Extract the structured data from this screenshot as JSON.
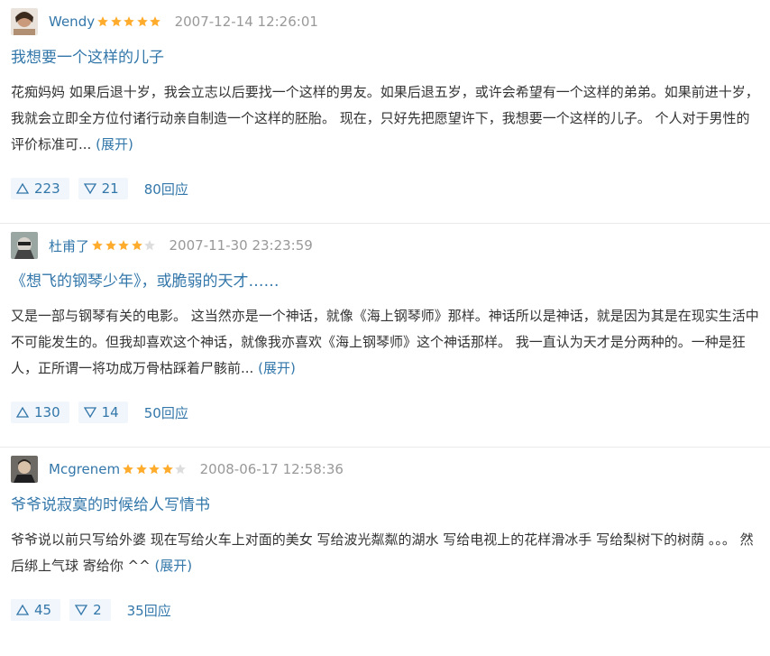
{
  "reviews": [
    {
      "user": "Wendy",
      "rating": 5,
      "time": "2007-12-14 12:26:01",
      "title": "我想要一个这样的儿子",
      "body": "花痴妈妈 如果后退十岁，我会立志以后要找一个这样的男友。如果后退五岁，或许会希望有一个这样的弟弟。如果前进十岁，我就会立即全方位付诸行动亲自制造一个这样的胚胎。 现在，只好先把愿望许下，我想要一个这样的儿子。 个人对于男性的评价标准可...",
      "expand": "(展开)",
      "up": "223",
      "down": "21",
      "replies": "80回应",
      "avatar": "avatar-wendy"
    },
    {
      "user": "杜甫了",
      "rating": 4,
      "time": "2007-11-30 23:23:59",
      "title": "《想飞的钢琴少年》，或脆弱的天才……",
      "body": "又是一部与钢琴有关的电影。 这当然亦是一个神话，就像《海上钢琴师》那样。神话所以是神话，就是因为其是在现实生活中不可能发生的。但我却喜欢这个神话，就像我亦喜欢《海上钢琴师》这个神话那样。 我一直认为天才是分两种的。一种是狂人，正所谓一将功成万骨枯踩着尸骸前...",
      "expand": "(展开)",
      "up": "130",
      "down": "14",
      "replies": "50回应",
      "avatar": "avatar-dufu"
    },
    {
      "user": "Mcgrenem",
      "rating": 4,
      "time": "2008-06-17 12:58:36",
      "title": "爷爷说寂寞的时候给人写情书",
      "body": "爷爷说以前只写给外婆 现在写给火车上对面的美女 写给波光粼粼的湖水 写给电视上的花样滑冰手 写给梨树下的树荫 。。。 然后绑上气球 寄给你 ^^ ",
      "expand": "(展开)",
      "up": "45",
      "down": "2",
      "replies": "35回应",
      "avatar": "avatar-mcgrenem"
    }
  ],
  "colors": {
    "link": "#3377aa",
    "star_on": "#ffac2d",
    "star_off": "#dddddd",
    "vote_bg": "#f0f6fb"
  }
}
